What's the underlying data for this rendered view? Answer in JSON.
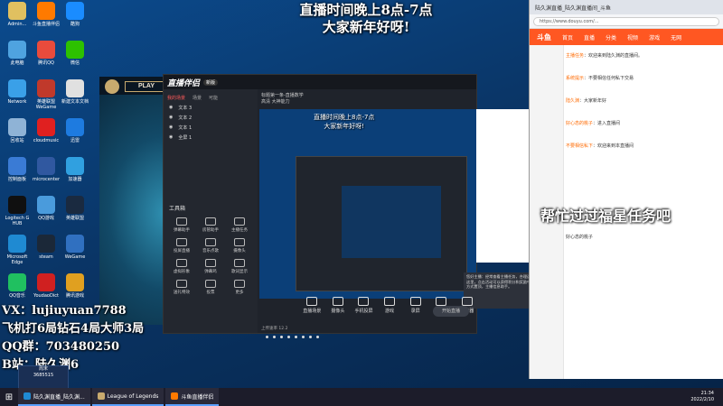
{
  "overlay": {
    "title_line1": "直播时间晚上8点-7点",
    "title_line2": "大家新年好呀!",
    "left_line1": "VX：lujiuyuan7788",
    "left_line2": "飞机打6局钻石4局大师3局",
    "left_line3": "QQ群：703480250",
    "left_line4": "B站：陆久渊6",
    "help_text": "帮忙过过福星任务吧"
  },
  "desktop_icons": [
    {
      "label": "Admin...",
      "color": "#e0c060"
    },
    {
      "label": "斗鱼直播伴侣",
      "color": "#ff7a00"
    },
    {
      "label": "酷狗",
      "color": "#1a8cff"
    },
    {
      "label": "此电脑",
      "color": "#4fa3e0"
    },
    {
      "label": "腾讯QQ",
      "color": "#e94b3c"
    },
    {
      "label": "微信",
      "color": "#2dc100"
    },
    {
      "label": "Network",
      "color": "#3aa0e8"
    },
    {
      "label": "英雄联盟WeGame",
      "color": "#c0392b"
    },
    {
      "label": "新建文本文档",
      "color": "#e0e0e0"
    },
    {
      "label": "回收站",
      "color": "#8fb3d6"
    },
    {
      "label": "cloudmusic",
      "color": "#e02020"
    },
    {
      "label": "迅雷",
      "color": "#1e7be0"
    },
    {
      "label": "控制面板",
      "color": "#3a7bd5"
    },
    {
      "label": "microcenter",
      "color": "#3058a0"
    },
    {
      "label": "加速器",
      "color": "#30a0e0"
    },
    {
      "label": "Logitech G HUB",
      "color": "#101010"
    },
    {
      "label": "QQ游戏",
      "color": "#4a9bdc"
    },
    {
      "label": "英雄联盟",
      "color": "#1a2a40"
    },
    {
      "label": "Microsoft Edge",
      "color": "#1f8ad2"
    },
    {
      "label": "steam",
      "color": "#1b2838"
    },
    {
      "label": "WeGame",
      "color": "#3070c0"
    },
    {
      "label": "QQ音乐",
      "color": "#20c060"
    },
    {
      "label": "YoudaoDict",
      "color": "#d02020"
    },
    {
      "label": "腾讯游戏",
      "color": "#e0a020"
    }
  ],
  "game": {
    "play_label": "PLAY"
  },
  "app": {
    "brand": "直播伴侣",
    "version": "新版",
    "side_tabs": [
      "我的场景",
      "场景",
      "可能"
    ],
    "layers": [
      "文本 3",
      "文本 2",
      "文本 1",
      "全屏 1"
    ],
    "tools_title": "工具箱",
    "tools": [
      "弹幕助手",
      "房管助手",
      "主播任务",
      "投屏直播",
      "音乐点歌",
      "摄像头",
      "虚拟形象",
      "弹幕鸡",
      "歌词显示",
      "送礼特效",
      "投票",
      "更多"
    ],
    "main_bar_title": "标题第一条-直播数学",
    "main_bar_sub": "高清  大神能力",
    "preview_title_line1": "直播时间晚上8点-7点",
    "preview_title_line2": "大家新年好呀!",
    "bottom_tools": [
      "直播场景",
      "摄像头",
      "手机投屏",
      "游戏",
      "录屏",
      "麦克风",
      "扬声器"
    ],
    "start_label": "开始直播",
    "status_text": "上传速率  12.2",
    "tip_text": "您好主播：经常查看主播任务，合理运营，更多福利可以在这里，点击活动可以获得积分和奖励中心查看，Ctrl+V快捷方式置顶，主播信息助手。"
  },
  "browser": {
    "tab_title": "陆久渊直播_陆久渊直播间_斗鱼",
    "url": "https://www.douyu.com/...",
    "nav": [
      "首页",
      "直播",
      "分类",
      "视频",
      "游戏",
      "无网"
    ],
    "chat": [
      {
        "user": "主播任务",
        "text": "欢迎来到陆久渊的直播间。"
      },
      {
        "user": "系统提示",
        "text": "不要相信任何私下交易"
      },
      {
        "user": "陆久渊",
        "text": "大家新年好"
      },
      {
        "user": "好心态的桃子",
        "text": "进入直播间"
      },
      {
        "user": "不要相信私下",
        "text": "欢迎来到本直播间"
      }
    ],
    "bottom_user": "好心态的桃子"
  },
  "cam": {
    "line1": "周末",
    "line2": "3685515"
  },
  "taskbar": {
    "items": [
      "陆久渊直播_陆久渊...",
      "League of Legends",
      "斗鱼直播伴侣"
    ],
    "time": "21:34",
    "date": "2022/2/10"
  }
}
